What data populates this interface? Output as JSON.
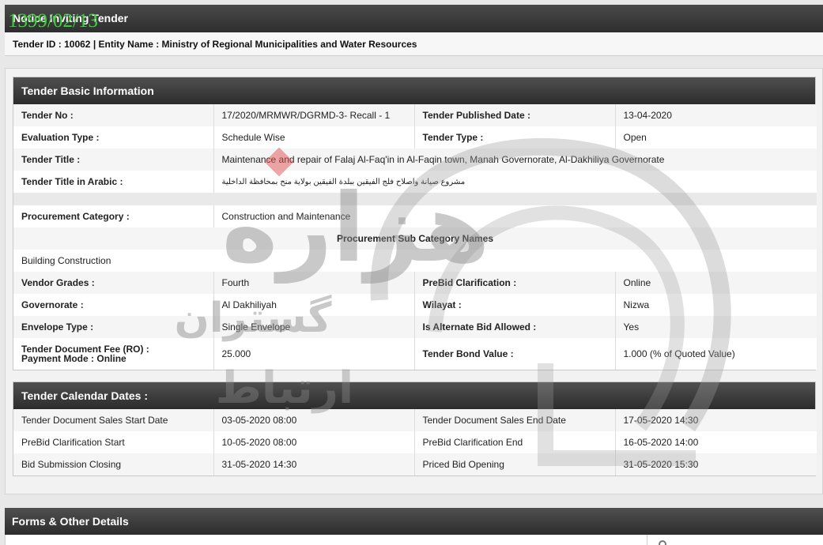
{
  "header": {
    "title": "Notice Inviting Tender",
    "date_stamp": "1399/02/13",
    "entity_line": "Tender ID : 10062 | Entity Name : Ministry of Regional Municipalities and Water Resources"
  },
  "basic": {
    "title": "Tender Basic Information",
    "tender_no_label": "Tender No :",
    "tender_no": "17/2020/MRMWR/DGRMD-3- Recall - 1",
    "published_label": "Tender Published Date :",
    "published": "13-04-2020",
    "evaluation_label": "Evaluation Type :",
    "evaluation": "Schedule Wise",
    "type_label": "Tender Type :",
    "type": "Open",
    "title_label": "Tender Title :",
    "tender_title": "Maintenance and repair of Falaj Al-Faq'in in Al-Faqin town, Manah Governorate, Al-Dakhiliya Governorate",
    "arabic_label": "Tender Title in Arabic :",
    "arabic_title": "مشروع صيانة واصلاح فلج الفيقين ببلدة الفيقين بولاية منح بمحافظة الداخلية",
    "procurement_label": "Procurement Category :",
    "procurement": "Construction and Maintenance",
    "subcat_heading": "Procurement Sub Category Names",
    "subcat": "Building Construction",
    "grades_label": "Vendor Grades :",
    "grades": "Fourth",
    "prebid_label": "PreBid Clarification :",
    "prebid": "Online",
    "gov_label": "Governorate :",
    "gov": "Al Dakhiliyah",
    "wilayat_label": "Wilayat :",
    "wilayat": "Nizwa",
    "envelope_label": "Envelope Type :",
    "envelope": "Single Envelope",
    "alternate_label": "Is Alternate Bid Allowed :",
    "alternate": "Yes",
    "fee_label": "Tender Document Fee (RO) :",
    "payment_label": "Payment Mode :",
    "payment": "Online",
    "fee": "25.000",
    "bond_label": "Tender Bond Value :",
    "bond": "1.000 (% of Quoted Value)"
  },
  "calendar": {
    "title": "Tender Calendar Dates :",
    "rows": [
      {
        "l1": "Tender Document Sales Start Date",
        "v1": "03-05-2020 08:00",
        "l2": "Tender Document Sales End Date",
        "v2": "17-05-2020 14:30"
      },
      {
        "l1": "PreBid Clarification Start",
        "v1": "10-05-2020 08:00",
        "l2": "PreBid Clarification End",
        "v2": "16-05-2020 14:00"
      },
      {
        "l1": "Bid Submission Closing",
        "v1": "31-05-2020 14:30",
        "l2": "Priced Bid Opening",
        "v2": "31-05-2020 15:30"
      }
    ]
  },
  "forms": {
    "title": "Forms & Other Details"
  },
  "watermark": {
    "line1": "هزاره",
    "line2": "گستران",
    "line3": "ارتباط"
  },
  "colors": {
    "header_dark": "#2e2e2e",
    "date_stamp": "#3cd13c",
    "watermark": "#8a8a8a",
    "watermark_accent": "#e05050"
  }
}
